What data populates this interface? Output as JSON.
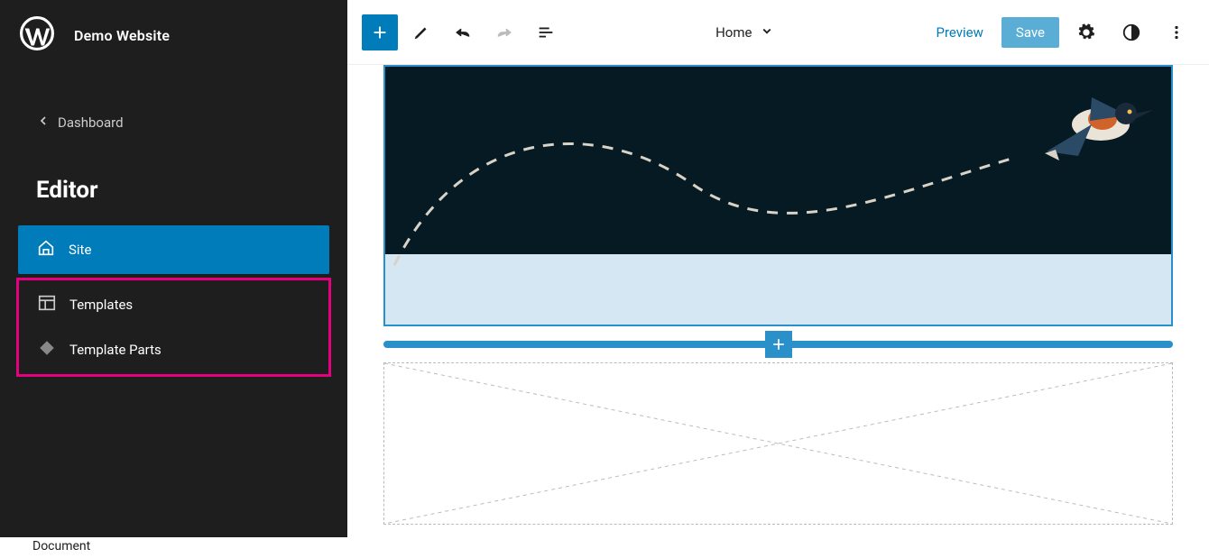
{
  "sidebar": {
    "site_title": "Demo Website",
    "back_label": "Dashboard",
    "heading": "Editor",
    "nav": {
      "site": "Site",
      "templates": "Templates",
      "template_parts": "Template Parts"
    }
  },
  "toolbar": {
    "document_title": "Home",
    "preview_label": "Preview",
    "save_label": "Save"
  },
  "icons": {
    "add": "plus-icon",
    "edit": "pencil-icon",
    "undo": "undo-icon",
    "redo": "redo-icon",
    "list": "list-view-icon",
    "chevron_down": "chevron-down-icon",
    "settings": "gear-icon",
    "styles": "contrast-icon",
    "more": "more-vertical-icon",
    "back": "chevron-left-icon",
    "home_icon": "home-icon",
    "layout_icon": "layout-icon",
    "diamond_icon": "diamond-icon"
  },
  "colors": {
    "accent": "#007cba",
    "highlight": "#e5007e",
    "dark_bg": "#061a23",
    "light_band": "#d5e7f2"
  },
  "footer": {
    "label": "Document"
  }
}
